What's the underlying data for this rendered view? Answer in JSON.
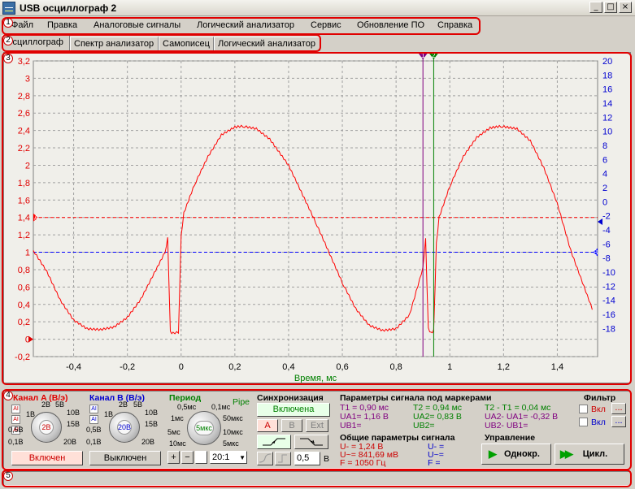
{
  "window": {
    "title": "USB осциллограф 2",
    "controls": [
      "_",
      "□",
      "×"
    ]
  },
  "menu": [
    "Файл",
    "Правка",
    "Аналоговые сигналы",
    "Логический анализатор",
    "Сервис",
    "Обновление ПО",
    "Справка"
  ],
  "tabs": [
    "Осциллограф",
    "Спектр анализатор",
    "Самописец",
    "Логический анализатор"
  ],
  "annotations": [
    "1",
    "2",
    "3",
    "4",
    "5"
  ],
  "chart_data": {
    "type": "line",
    "xlabel": "Время, мс",
    "xlim": [
      -0.55,
      1.55
    ],
    "ylim_left": [
      -0.2,
      3.2
    ],
    "ylim_right": [
      -22,
      20
    ],
    "x_ticks": [
      "-0,4",
      "-0,2",
      "0",
      "0,2",
      "0,4",
      "0,6",
      "0,8",
      "1",
      "1,2",
      "1,4"
    ],
    "left_ticks": [
      "3,2",
      "3",
      "2,8",
      "2,6",
      "2,4",
      "2,2",
      "2",
      "1,8",
      "1,6",
      "1,4",
      "1,2",
      "1",
      "0,8",
      "0,6",
      "0,4",
      "0,2",
      "0",
      "-0,2"
    ],
    "right_ticks": [
      "20",
      "18",
      "16",
      "14",
      "12",
      "10",
      "8",
      "6",
      "4",
      "2",
      "0",
      "-2",
      "-4",
      "-6",
      "-8",
      "-10",
      "-12",
      "-14",
      "-16",
      "-18"
    ],
    "grid": true,
    "series": [
      {
        "color": "#ff0000",
        "x": [
          -0.55,
          -0.5,
          -0.45,
          -0.4,
          -0.35,
          -0.3,
          -0.25,
          -0.2,
          -0.15,
          -0.1,
          -0.06,
          -0.05,
          -0.04,
          -0.03,
          -0.01,
          0.0,
          0.01,
          0.05,
          0.1,
          0.15,
          0.2,
          0.23,
          0.28,
          0.33,
          0.4,
          0.5,
          0.6,
          0.65,
          0.7,
          0.75,
          0.8,
          0.85,
          0.9,
          0.91,
          0.92,
          0.93,
          0.94,
          0.95,
          0.96,
          1.0,
          1.05,
          1.1,
          1.15,
          1.19,
          1.25,
          1.3,
          1.35,
          1.4,
          1.45,
          1.5,
          1.53
        ],
        "y": [
          1.02,
          0.78,
          0.45,
          0.22,
          0.12,
          0.11,
          0.14,
          0.25,
          0.46,
          0.76,
          1.0,
          1.16,
          0.08,
          0.07,
          0.08,
          1.18,
          1.45,
          1.78,
          2.1,
          2.35,
          2.44,
          2.45,
          2.42,
          2.3,
          2.0,
          1.35,
          0.65,
          0.35,
          0.16,
          0.1,
          0.12,
          0.28,
          0.82,
          1.15,
          0.12,
          0.07,
          0.1,
          1.1,
          1.4,
          1.76,
          2.1,
          2.32,
          2.43,
          2.45,
          2.42,
          2.28,
          1.97,
          1.56,
          1.02,
          0.6,
          0.35
        ]
      }
    ],
    "ref_lines": [
      {
        "label": "A",
        "value": 1.4,
        "color": "#ff0000"
      },
      {
        "label": "B",
        "value": 1.0,
        "color": "#0000ff"
      }
    ],
    "markers": [
      {
        "label": "1",
        "x": 0.9,
        "color": "#800080"
      },
      {
        "label": "2",
        "x": 0.94,
        "color": "#008000"
      }
    ]
  },
  "bottom": {
    "chA": {
      "title": "Канал A (В/э)",
      "scales": [
        "1В",
        "2В",
        "5В",
        "10В",
        "15В",
        "20В",
        "0,5В",
        "0,1В"
      ],
      "value": "2В",
      "button": "Включен",
      "mode_icons": [
        "AI",
        "AI",
        "AI"
      ]
    },
    "chB": {
      "title": "Канал B (В/э)",
      "scales": [
        "1В",
        "2В",
        "5В",
        "10В",
        "15В",
        "20В",
        "0,5В",
        "0,1В"
      ],
      "value": "20В",
      "button": "Выключен",
      "mode_icons": [
        "AI",
        "AI"
      ]
    },
    "period": {
      "title": "Период",
      "pipe": "Pipe",
      "scales": [
        "0,5мс",
        "0,1мс",
        "1мс",
        "50мкс",
        "5мс",
        "10мкс",
        "10мс",
        "5мкс"
      ],
      "value": "5мкс",
      "zoom": "20:1"
    },
    "sync": {
      "title": "Синхронизация",
      "enabled": "Включена",
      "sources": [
        "A",
        "B",
        "Ext"
      ],
      "level": "0,5",
      "unit": "В"
    },
    "markers_params": {
      "title": "Параметры сигнала под маркерами",
      "T1": "T1 = 0,90 мс",
      "UA1": "UA1= 1,16 В",
      "UB1": "UB1=",
      "T2": "T2 = 0,94 мс",
      "UA2": "UA2= 0,83 В",
      "UB2": "UB2=",
      "DT": "T2 - T1 = 0,04 мс",
      "DUA": "UA2- UA1= -0,32 В",
      "DUB": "UB2- UB1="
    },
    "general": {
      "title": "Общие параметры сигнала",
      "Ua": "U- = 1,24 В",
      "Uac": "U~= 841,69 мВ",
      "F": "F = 1050 Гц",
      "Ub": "U- =",
      "Ubc": "U~=",
      "Fb": "F ="
    },
    "filter": {
      "title": "Фильтр",
      "on": "Вкл",
      "more": "..."
    },
    "control": {
      "title": "Управление",
      "single": "Однокр.",
      "cycle": "Цикл."
    }
  }
}
